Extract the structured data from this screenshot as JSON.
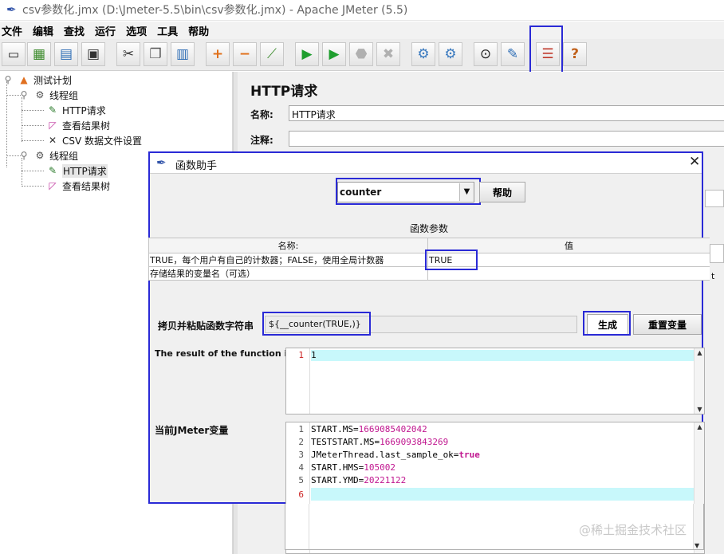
{
  "window": {
    "title": "csv参数化.jmx (D:\\Jmeter-5.5\\bin\\csv参数化.jmx) - Apache JMeter (5.5)"
  },
  "menu": [
    "文件",
    "编辑",
    "查找",
    "运行",
    "选项",
    "工具",
    "帮助"
  ],
  "toolbar": {
    "buttons": [
      "new-icon",
      "templates-icon",
      "open-icon",
      "save-icon",
      "cut-icon",
      "copy-icon",
      "paste-icon",
      "expand-icon",
      "collapse-icon",
      "toggle-icon",
      "start-icon",
      "start-no-pause-icon",
      "stop-icon",
      "shutdown-icon",
      "clear-icon",
      "clear-all-icon",
      "search-icon",
      "reset-search-icon",
      "function-helper-icon",
      "help-icon"
    ]
  },
  "tree": {
    "items": [
      {
        "label": "测试计划",
        "icon": "test-plan-icon"
      },
      {
        "label": "线程组",
        "icon": "thread-group-icon"
      },
      {
        "label": "HTTP请求",
        "icon": "pipette-icon"
      },
      {
        "label": "查看结果树",
        "icon": "chart-icon"
      },
      {
        "label": "CSV 数据文件设置",
        "icon": "tools-icon"
      },
      {
        "label": "线程组",
        "icon": "thread-group-icon"
      },
      {
        "label": "HTTP请求",
        "icon": "pipette-icon"
      },
      {
        "label": "查看结果树",
        "icon": "chart-icon"
      }
    ]
  },
  "panel": {
    "title": "HTTP请求",
    "name_label": "名称:",
    "name_value": "HTTP请求",
    "comment_label": "注释:",
    "side_fragment": "t"
  },
  "dialog": {
    "title": "函数助手",
    "function_selected": "counter",
    "help_button": "帮助",
    "params_title": "函数参数",
    "col_name": "名称:",
    "col_value": "值",
    "params": [
      {
        "name": "TRUE，每个用户有自己的计数器；FALSE，使用全局计数器",
        "value": "TRUE"
      },
      {
        "name": "存储结果的变量名（可选）",
        "value": ""
      }
    ],
    "copy_label": "拷贝并粘贴函数字符串",
    "function_string": "${__counter(TRUE,)}",
    "generate_button": "生成",
    "reset_button": "重置变量",
    "result_label": "The result of the function is",
    "result_lines": [
      {
        "n": "1",
        "text": "1"
      }
    ],
    "vars_label": "当前JMeter变量",
    "vars_lines": [
      {
        "n": "1",
        "key": "START.MS=",
        "val": "1669085402042"
      },
      {
        "n": "2",
        "key": "TESTSTART.MS=",
        "val": "1669093843269"
      },
      {
        "n": "3",
        "key": "JMeterThread.last_sample_ok=",
        "val": "true"
      },
      {
        "n": "4",
        "key": "START.HMS=",
        "val": "105002"
      },
      {
        "n": "5",
        "key": "START.YMD=",
        "val": "20221122"
      },
      {
        "n": "6",
        "key": "",
        "val": ""
      }
    ]
  },
  "watermark": "@稀土掘金技术社区",
  "colors": {
    "highlight": "#2a2ad6",
    "current_line": "#c8f8fb",
    "value": "#c0168f"
  }
}
